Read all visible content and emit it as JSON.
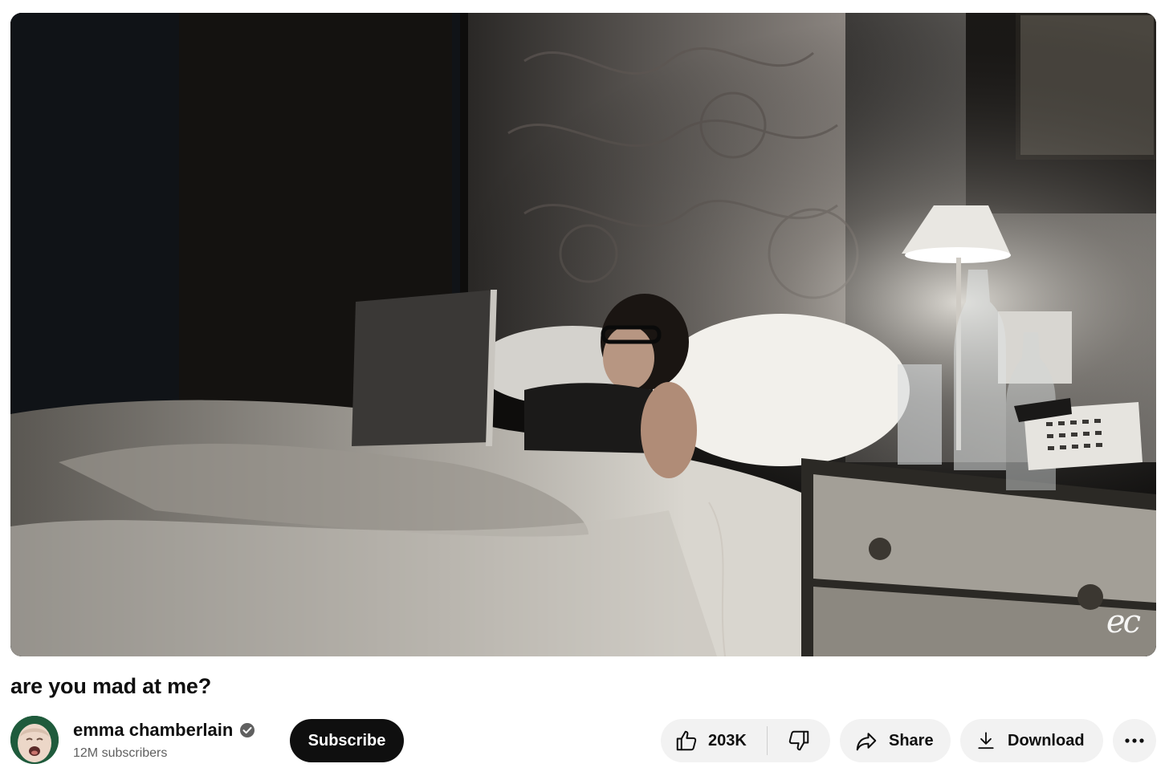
{
  "video": {
    "title": "are you mad at me?",
    "watermark": "ec"
  },
  "channel": {
    "name": "emma chamberlain",
    "subscribers": "12M subscribers",
    "verified": true,
    "avatar_icon": "baby-crying-avatar"
  },
  "actions": {
    "subscribe_label": "Subscribe",
    "likes": "203K",
    "share_label": "Share",
    "download_label": "Download",
    "icons": {
      "like": "thumbs-up-icon",
      "dislike": "thumbs-down-icon",
      "share": "share-arrow-icon",
      "download": "download-icon",
      "more": "more-horizontal-icon"
    }
  },
  "colors": {
    "subscribe_bg": "#0f0f0f",
    "pill_bg": "#f2f2f2",
    "text_primary": "#0f0f0f",
    "text_secondary": "#606060"
  }
}
